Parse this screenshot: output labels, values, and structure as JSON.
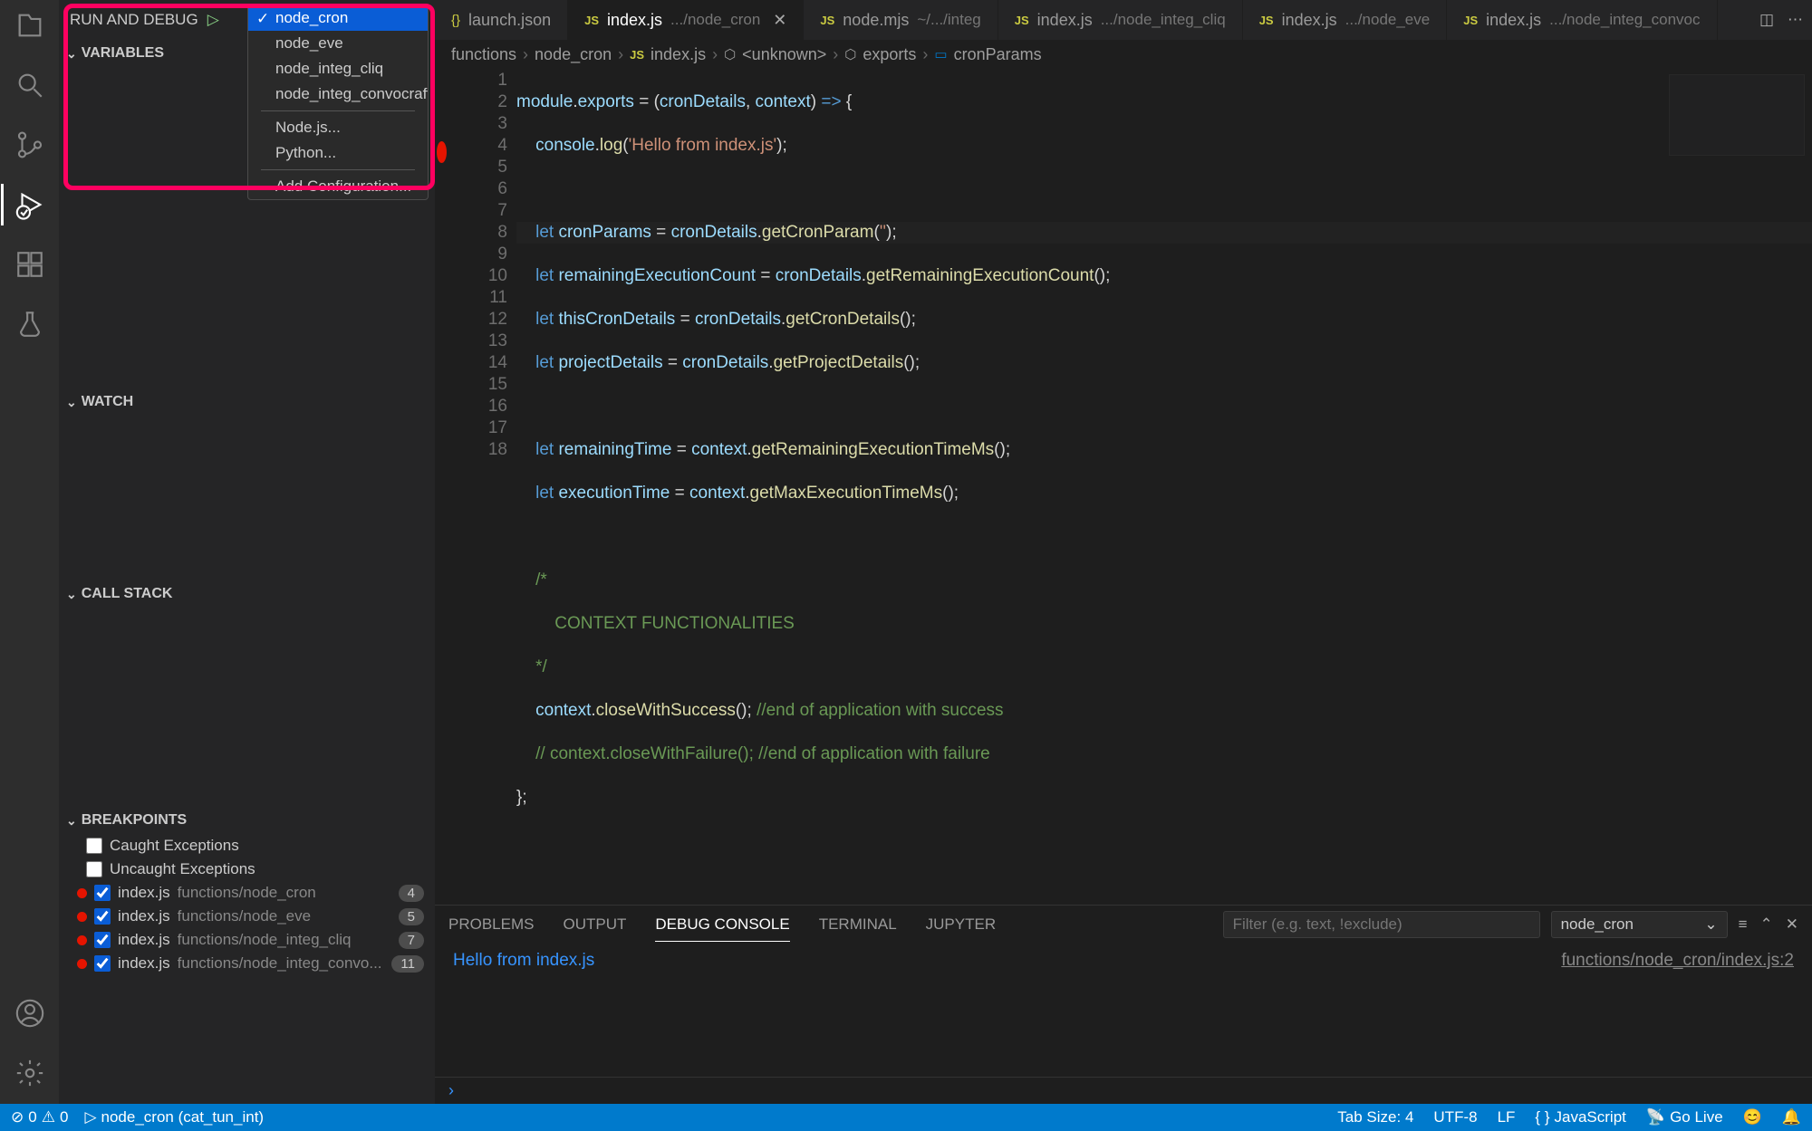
{
  "sidebar": {
    "title": "RUN AND DEBUG",
    "configs": [
      "node_cron",
      "node_eve",
      "node_integ_cliq",
      "node_integ_convocraft"
    ],
    "selected": "node_cron",
    "envs": [
      "Node.js...",
      "Python..."
    ],
    "add_config": "Add Configuration...",
    "sections": {
      "variables": "VARIABLES",
      "watch": "WATCH",
      "callstack": "CALL STACK",
      "breakpoints": "BREAKPOINTS"
    }
  },
  "breakpoints": {
    "exc": [
      {
        "label": "Caught Exceptions",
        "checked": false
      },
      {
        "label": "Uncaught Exceptions",
        "checked": false
      }
    ],
    "items": [
      {
        "file": "index.js",
        "path": "functions/node_cron",
        "line": "4"
      },
      {
        "file": "index.js",
        "path": "functions/node_eve",
        "line": "5"
      },
      {
        "file": "index.js",
        "path": "functions/node_integ_cliq",
        "line": "7"
      },
      {
        "file": "index.js",
        "path": "functions/node_integ_convo...",
        "line": "11"
      }
    ]
  },
  "tabs": [
    {
      "kind": "json",
      "name": "launch.json"
    },
    {
      "kind": "js",
      "name": "index.js",
      "desc": ".../node_cron",
      "active": true
    },
    {
      "kind": "js",
      "name": "node.mjs",
      "desc": "~/.../integ"
    },
    {
      "kind": "js",
      "name": "index.js",
      "desc": ".../node_integ_cliq"
    },
    {
      "kind": "js",
      "name": "index.js",
      "desc": ".../node_eve"
    },
    {
      "kind": "js",
      "name": "index.js",
      "desc": ".../node_integ_convoc"
    }
  ],
  "breadcrumbs": [
    "functions",
    "node_cron",
    "index.js",
    "<unknown>",
    "exports",
    "cronParams"
  ],
  "console": {
    "out": "Hello from index.js",
    "src": "functions/node_cron/index.js:2"
  },
  "panel": {
    "tabs": [
      "PROBLEMS",
      "OUTPUT",
      "DEBUG CONSOLE",
      "TERMINAL",
      "JUPYTER"
    ],
    "active": 2,
    "filter_placeholder": "Filter (e.g. text, !exclude)",
    "select": "node_cron"
  },
  "status": {
    "errors": "0",
    "warnings": "0",
    "config": "node_cron (cat_tun_int)",
    "tab_size": "Tab Size: 4",
    "encoding": "UTF-8",
    "eol": "LF",
    "lang": "JavaScript",
    "golive": "Go Live"
  }
}
